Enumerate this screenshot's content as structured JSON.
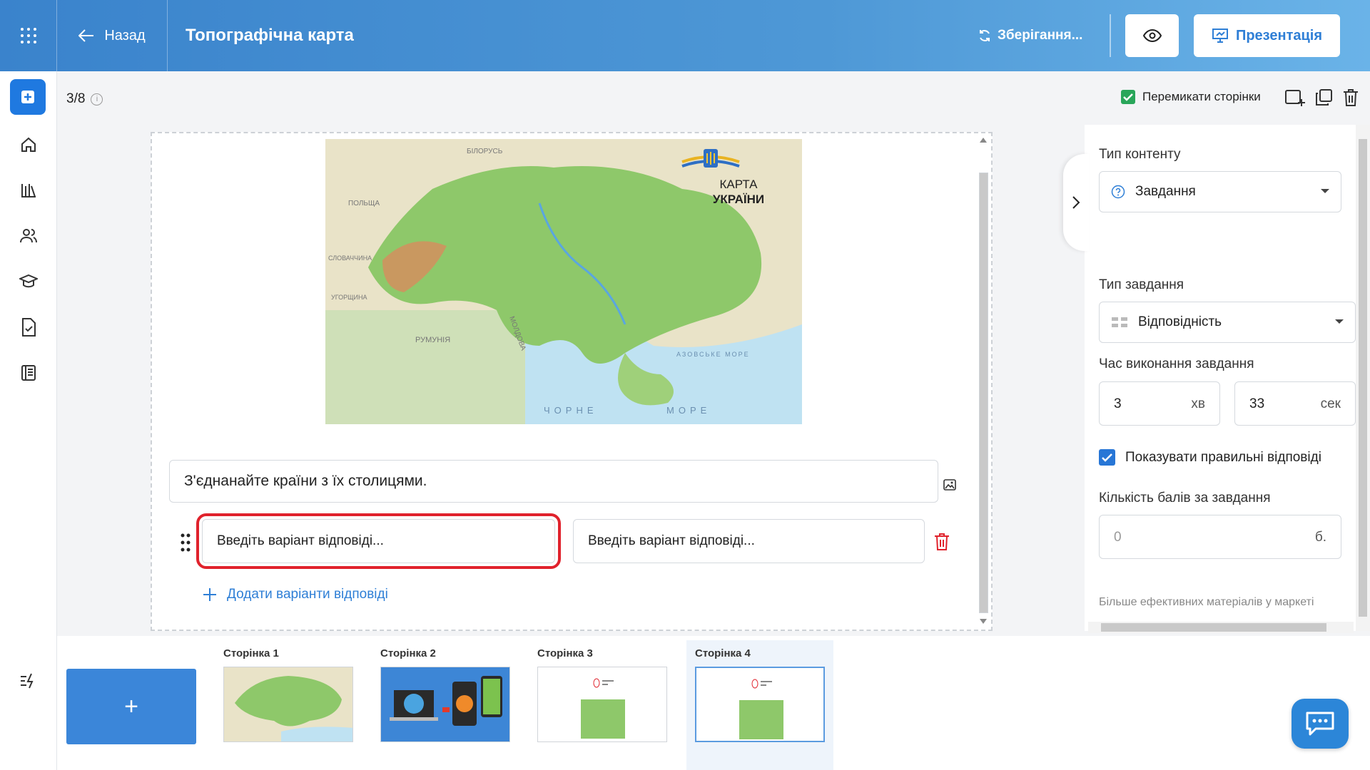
{
  "header": {
    "back_label": "Назад",
    "title": "Топографічна карта",
    "saving_label": "Зберігання...",
    "present_label": "Презентація"
  },
  "toolbar": {
    "page_counter": "3/8",
    "switch_pages_label": "Перемикати сторінки",
    "switch_pages_checked": true
  },
  "map": {
    "title_line1": "КАРТА",
    "title_line2": "УКРАЇНИ",
    "labels": [
      "БІЛОРУСЬ",
      "ПОЛЬЩА",
      "СЛОВАЧЧИНА",
      "УГОРЩИНА",
      "РУМУНІЯ",
      "МОЛДОВА",
      "АЗОВСЬКЕ МОРЕ",
      "ЧОРНЕ",
      "МОРЕ"
    ]
  },
  "task": {
    "question": "З'єднанайте країни з їх столицями.",
    "answer_left_placeholder": "Введіть варіант відповіді...",
    "answer_right_placeholder": "Введіть варіант відповіді...",
    "add_answers_label": "Додати варіанти відповіді"
  },
  "settings": {
    "content_type_label": "Тип контенту",
    "content_type_value": "Завдання",
    "task_type_label": "Тип завдання",
    "task_type_value": "Відповідність",
    "time_label": "Час виконання завдання",
    "time_min": "3",
    "time_min_unit": "хв",
    "time_sec": "33",
    "time_sec_unit": "сек",
    "show_answers_label": "Показувати правильні відповіді",
    "show_answers_checked": true,
    "points_label": "Кількість балів за завдання",
    "points_placeholder": "0",
    "points_unit": "б.",
    "market_text": "Більше ефективних матеріалів у маркеті"
  },
  "pages": [
    {
      "label": "Сторінка 1"
    },
    {
      "label": "Сторінка 2"
    },
    {
      "label": "Сторінка 3"
    },
    {
      "label": "Сторінка 4"
    }
  ],
  "add_page_label": "+",
  "colors": {
    "accent": "#2f7fd6",
    "highlight": "#e0222c",
    "check_green": "#29a65a"
  }
}
